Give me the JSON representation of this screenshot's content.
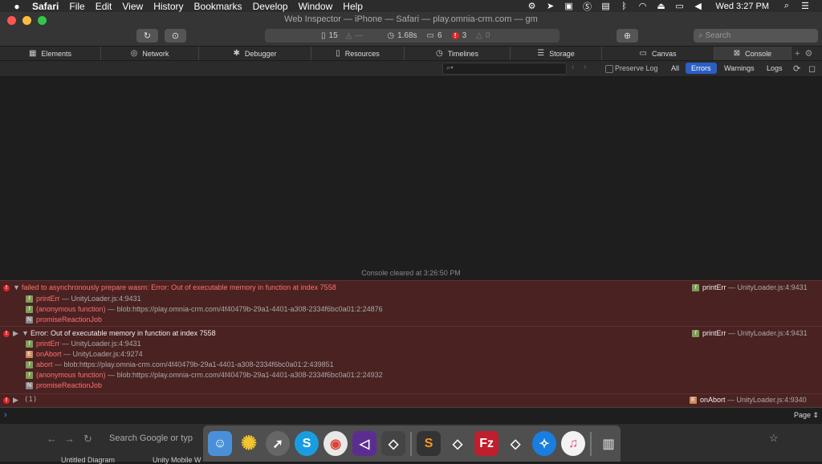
{
  "menubar": {
    "app": "Safari",
    "items": [
      "File",
      "Edit",
      "View",
      "History",
      "Bookmarks",
      "Develop",
      "Window",
      "Help"
    ],
    "clock": "Wed 3:27 PM"
  },
  "window": {
    "title": "Web Inspector — iPhone — Safari — play.omnia-crm.com — gm"
  },
  "dashboard": {
    "resources": "15",
    "resources_size": "—",
    "load_time": "1.68s",
    "logs": "6",
    "errors": "3",
    "warnings": "0"
  },
  "search": {
    "placeholder": "Search"
  },
  "tabs": [
    {
      "label": "Elements",
      "icon": "elements-icon"
    },
    {
      "label": "Network",
      "icon": "network-icon"
    },
    {
      "label": "Debugger",
      "icon": "debugger-icon"
    },
    {
      "label": "Resources",
      "icon": "resources-icon"
    },
    {
      "label": "Timelines",
      "icon": "timelines-icon"
    },
    {
      "label": "Storage",
      "icon": "storage-icon"
    },
    {
      "label": "Canvas",
      "icon": "canvas-icon"
    },
    {
      "label": "Console",
      "icon": "console-icon"
    }
  ],
  "filter": {
    "preserve_log": "Preserve Log",
    "all": "All",
    "errors": "Errors",
    "warnings": "Warnings",
    "logs": "Logs"
  },
  "console": {
    "cleared": "Console cleared at 3:26:50 PM",
    "messages": [
      {
        "text": "failed to asynchronously prepare wasm: Error: Out of executable memory in function at index 7558",
        "source_fn": "printErr",
        "source_loc": "UnityLoader.js:4:9431",
        "trace": [
          {
            "type": "f",
            "fn": "printErr",
            "loc": "UnityLoader.js:4:9431"
          },
          {
            "type": "f",
            "fn": "(anonymous function)",
            "loc": "blob:https://play.omnia-crm.com/4f40479b-29a1-4401-a308-2334f6bc0a01:2:24876"
          },
          {
            "type": "n",
            "fn": "promiseReactionJob",
            "loc": ""
          }
        ]
      },
      {
        "text": "Error: Out of executable memory in function at index 7558",
        "source_fn": "printErr",
        "source_loc": "UnityLoader.js:4:9431",
        "trace": [
          {
            "type": "f",
            "fn": "printErr",
            "loc": "UnityLoader.js:4:9431"
          },
          {
            "type": "e",
            "fn": "onAbort",
            "loc": "UnityLoader.js:4:9274"
          },
          {
            "type": "f",
            "fn": "abort",
            "loc": "blob:https://play.omnia-crm.com/4f40479b-29a1-4401-a308-2334f6bc0a01:2:439851"
          },
          {
            "type": "f",
            "fn": "(anonymous function)",
            "loc": "blob:https://play.omnia-crm.com/4f40479b-29a1-4401-a308-2334f6bc0a01:2:24932"
          },
          {
            "type": "n",
            "fn": "promiseReactionJob",
            "loc": ""
          }
        ]
      },
      {
        "text": "(1)",
        "source_fn": "onAbort",
        "source_loc": "UnityLoader.js:4:9340"
      }
    ],
    "page_select": "Page"
  },
  "background": {
    "search_placeholder": "Search Google or typ",
    "tab1": "Untitled Diagram",
    "tab2": "Unity Mobile W"
  },
  "dock": {
    "apps": [
      "finder-icon",
      "sun-icon",
      "launchpad-icon",
      "skype-icon",
      "chrome-icon",
      "visual-studio-icon",
      "unity-icon",
      "sublime-icon",
      "unity-icon",
      "filezilla-icon",
      "unity-icon",
      "safari-icon",
      "itunes-icon",
      "trash-icon"
    ]
  }
}
